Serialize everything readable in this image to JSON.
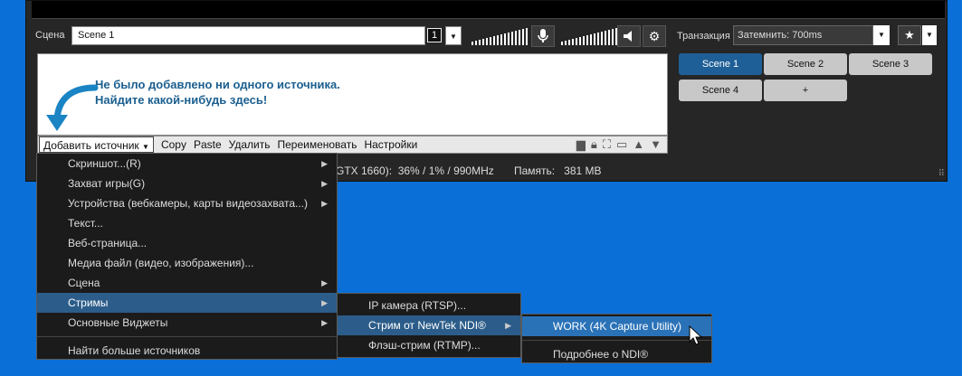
{
  "scene_bar": {
    "label": "Сцена",
    "value": "Scene 1",
    "index": "1"
  },
  "transition": {
    "label": "Транзакция",
    "value": "Затемнить: 700ms"
  },
  "scenes": [
    {
      "label": "Scene 1",
      "active": true
    },
    {
      "label": "Scene 2",
      "active": false
    },
    {
      "label": "Scene 3",
      "active": false
    },
    {
      "label": "Scene 4",
      "active": false
    },
    {
      "label": "+",
      "active": false
    }
  ],
  "sources": {
    "empty_line1": "Не было добавлено ни одного источника.",
    "empty_line2": "Найдите какой-нибудь здесь!"
  },
  "source_toolbar": {
    "add": "Добавить источник",
    "copy": "Copy",
    "paste": "Paste",
    "delete": "Удалить",
    "rename": "Переименовать",
    "settings": "Настройки"
  },
  "status": {
    "gpu_text": "GTX 1660):",
    "gpu_values": "36% / 1% / 990MHz",
    "mem_label": "Память:",
    "mem_value": "381 MB"
  },
  "menu_main": [
    {
      "label": "Скриншот...(R)",
      "submenu": true
    },
    {
      "label": "Захват игры(G)",
      "submenu": true
    },
    {
      "label": "Устройства (вебкамеры, карты видеозахвата...)",
      "submenu": true
    },
    {
      "label": "Текст...",
      "submenu": false
    },
    {
      "label": "Веб-страница...",
      "submenu": false
    },
    {
      "label": "Медиа файл (видео, изображения)...",
      "submenu": false
    },
    {
      "label": "Сцена",
      "submenu": true
    },
    {
      "label": "Стримы",
      "submenu": true
    },
    {
      "label": "Основные Виджеты",
      "submenu": true
    },
    {
      "label": "Найти больше источников",
      "submenu": false
    }
  ],
  "menu_streams": [
    {
      "label": "IP камера (RTSP)..."
    },
    {
      "label": "Стрим от NewTek NDI®"
    },
    {
      "label": "Флэш-стрим (RTMP)..."
    }
  ],
  "menu_ndi": [
    {
      "label": "WORK (4K Capture Utility)"
    },
    {
      "label": "Подробнее о NDI®"
    }
  ],
  "colors": {
    "desktop": "#0a6fd6",
    "panel": "#262626",
    "accent": "#1f5f97"
  }
}
